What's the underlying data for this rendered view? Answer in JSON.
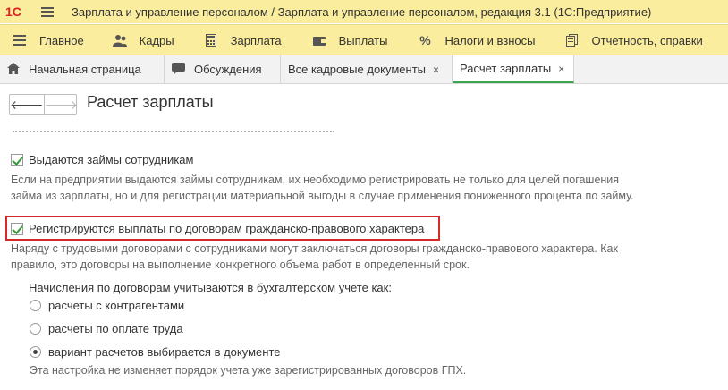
{
  "window": {
    "logo": "1С",
    "title": "Зарплата и управление персоналом / Зарплата и управление персоналом, редакция 3.1  (1С:Предприятие)"
  },
  "sections": [
    {
      "label": "Главное",
      "icon": "hamburger-icon"
    },
    {
      "label": "Кадры",
      "icon": "people-icon"
    },
    {
      "label": "Зарплата",
      "icon": "calculator-icon"
    },
    {
      "label": "Выплаты",
      "icon": "wallet-icon"
    },
    {
      "label": "Налоги и взносы",
      "icon": "percent-icon"
    },
    {
      "label": "Отчетность, справки",
      "icon": "reports-icon"
    }
  ],
  "tabs": [
    {
      "label": "Начальная страница",
      "icon": "home-icon"
    },
    {
      "label": "Обсуждения",
      "icon": "chat-icon"
    },
    {
      "label": "Все кадровые документы",
      "close": "×"
    },
    {
      "label": "Расчет зарплаты",
      "close": "×",
      "active": true
    }
  ],
  "page": {
    "title": "Расчет зарплаты",
    "back": "🡐",
    "forward": "🡒"
  },
  "settings": {
    "loans": {
      "label": "Выдаются займы сотрудникам",
      "checked": true,
      "description_line1": "Если на предприятии выдаются займы сотрудникам, их необходимо регистрировать не только для целей погашения",
      "description_line2": "займа из зарплаты, но и для регистрации материальной выгоды в случае применения пониженного процента по займу."
    },
    "gph": {
      "label": "Регистрируются выплаты по договорам гражданско-правового характера",
      "checked": true,
      "description_line1": "Наряду с трудовыми договорами с сотрудниками могут заключаться договоры гражданско-правового характера. Как",
      "description_line2": "правило, это договоры на выполнение конкретного объема работ в определенный срок."
    },
    "accounting": {
      "label": "Начисления по договорам учитываются в бухгалтерском учете как:",
      "options": [
        {
          "label": "расчеты с контрагентами",
          "selected": false
        },
        {
          "label": "расчеты по оплате труда",
          "selected": false
        },
        {
          "label": "вариант расчетов выбирается в документе",
          "selected": true
        }
      ],
      "note": "Эта настройка не изменяет порядок учета уже зарегистрированных договоров ГПХ."
    }
  },
  "colors": {
    "toolbar": "#fbed9e",
    "accent_green": "#3ba44f",
    "highlight_red": "#d42a2a"
  }
}
